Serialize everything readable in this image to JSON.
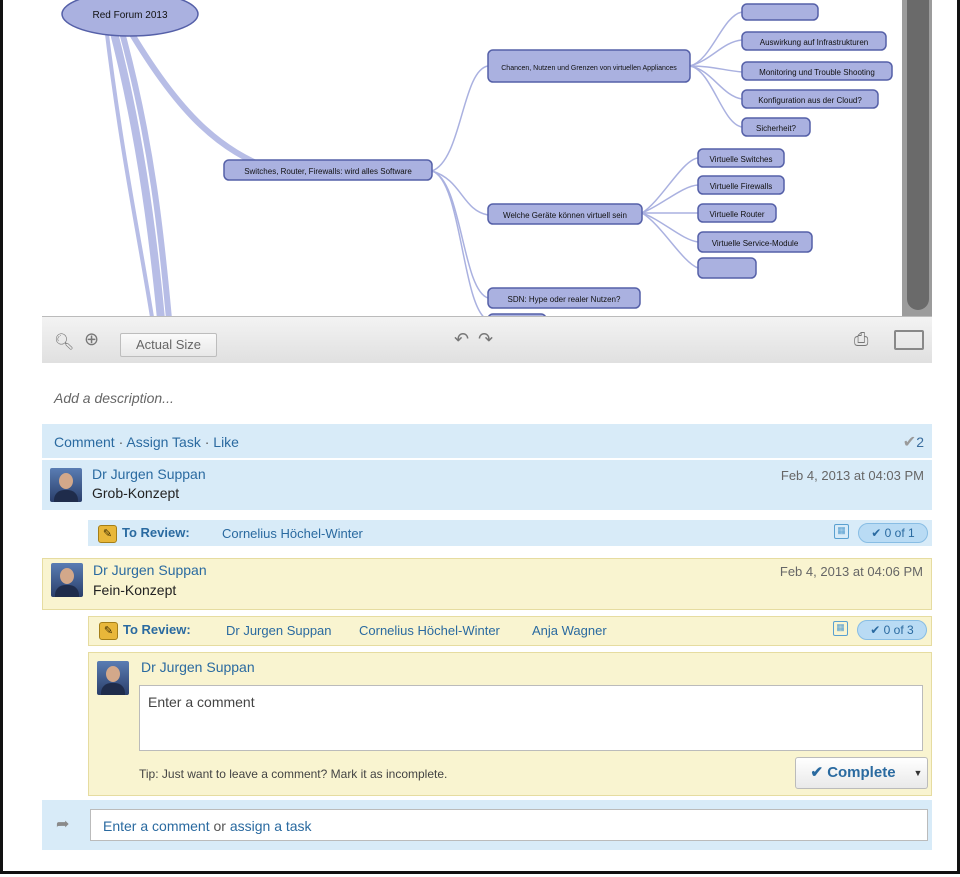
{
  "mindmap": {
    "root": "Red Forum 2013",
    "branch_main": "Switches, Router, Firewalls: wird alles Software",
    "sub1": "Chancen, Nutzen und Grenzen von virtuellen Appliances",
    "sub1_leaves": [
      "Auswirkung auf Infrastrukturen",
      "Monitoring und Trouble Shooting",
      "Konfiguration aus der Cloud?",
      "Sicherheit?"
    ],
    "sub2": "Welche Geräte können virtuell sein",
    "sub2_leaves": [
      "Virtuelle Switches",
      "Virtuelle Firewalls",
      "Virtuelle Router",
      "Virtuelle Service-Module",
      ""
    ],
    "sub3": "SDN: Hype oder realer Nutzen?"
  },
  "toolbar": {
    "actual_size": "Actual Size"
  },
  "description_placeholder": "Add a description...",
  "actions": {
    "comment": "Comment",
    "assign": "Assign Task",
    "like": "Like",
    "sep": "·",
    "likes_count": "2"
  },
  "comments": [
    {
      "author": "Dr Jurgen Suppan",
      "text": "Grob-Konzept",
      "date": "Feb 4, 2013 at 04:03 PM",
      "task": {
        "label": "To Review:",
        "users": [
          "Cornelius Höchel-Winter"
        ],
        "progress": "✔ 0 of 1"
      }
    },
    {
      "author": "Dr Jurgen Suppan",
      "text": "Fein-Konzept",
      "date": "Feb 4, 2013 at 04:06 PM",
      "task": {
        "label": "To Review:",
        "users": [
          "Dr Jurgen Suppan",
          "Cornelius Höchel-Winter",
          "Anja Wagner"
        ],
        "progress": "✔ 0 of 3"
      }
    }
  ],
  "reply": {
    "author": "Dr Jurgen Suppan",
    "placeholder": "Enter a comment",
    "tip": "Tip: Just want to leave a comment? Mark it as incomplete.",
    "complete_label": "✔ Complete"
  },
  "footer": {
    "part1": "Enter a comment",
    "part2": " or ",
    "part3": "assign a task"
  },
  "colors": {
    "node_fill": "#aab1e0",
    "node_stroke": "#5560a8",
    "link_blue": "#2a6aa0",
    "blue_band": "#d8ebf8",
    "yellow_band": "#f9f4d0"
  }
}
